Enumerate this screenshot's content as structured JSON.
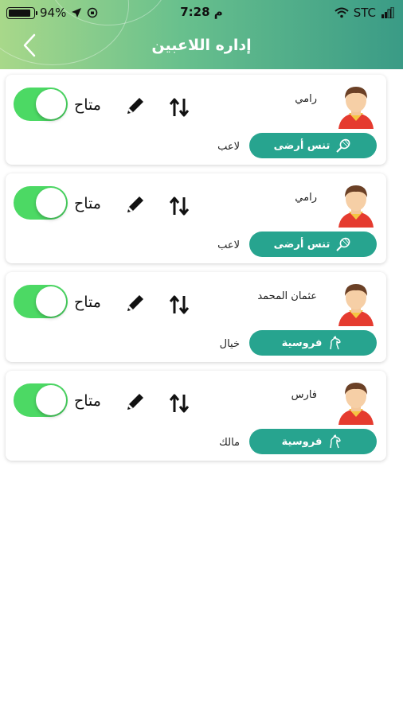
{
  "status_bar": {
    "battery": "94%",
    "time": "7:28 م",
    "carrier": "STC"
  },
  "header": {
    "title": "إداره اللاعبين",
    "back_icon": "chevron-left-icon"
  },
  "players": [
    {
      "name": "رامي",
      "status": "متاح",
      "enabled": true,
      "sport": "تنس أرضى",
      "sport_icon": "tennis-racket-icon",
      "role": "لاعب"
    },
    {
      "name": "رامي",
      "status": "متاح",
      "enabled": true,
      "sport": "تنس أرضى",
      "sport_icon": "tennis-racket-icon",
      "role": "لاعب"
    },
    {
      "name": "عثمان المحمد",
      "status": "متاح",
      "enabled": true,
      "sport": "فروسية",
      "sport_icon": "horse-icon",
      "role": "خيال"
    },
    {
      "name": "فارس",
      "status": "متاح",
      "enabled": true,
      "sport": "فروسية",
      "sport_icon": "horse-icon",
      "role": "مالك"
    }
  ],
  "colors": {
    "badge": "#27a48f",
    "toggle_on": "#4cd964",
    "header_start": "#a8d88a",
    "header_end": "#3a9b86"
  }
}
